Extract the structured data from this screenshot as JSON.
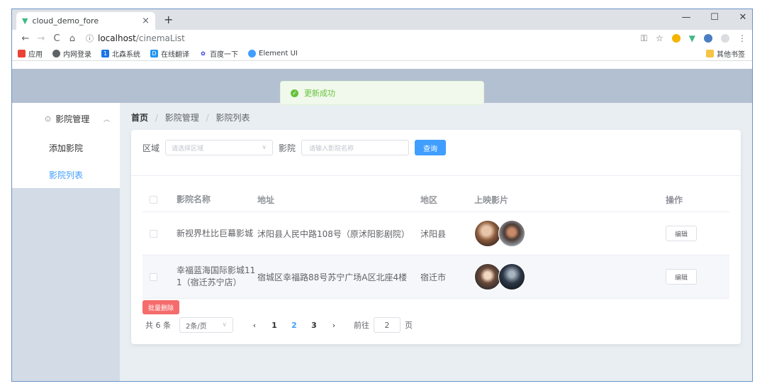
{
  "browser": {
    "tab_title": "cloud_demo_fore",
    "url_host": "localhost",
    "url_path": "/cinemaList",
    "bookmarks": [
      "应用",
      "内网登录",
      "北森系统",
      "在线翻译",
      "百度一下",
      "Element UI"
    ],
    "other_bookmarks": "其他书签"
  },
  "toast": {
    "message": "更新成功"
  },
  "sidebar": {
    "group_title": "影院管理",
    "items": [
      {
        "label": "添加影院"
      },
      {
        "label": "影院列表"
      }
    ]
  },
  "breadcrumb": [
    "首页",
    "影院管理",
    "影院列表"
  ],
  "search": {
    "region_label": "区域",
    "region_placeholder": "请选择区域",
    "cinema_label": "影院",
    "cinema_placeholder": "请输入影院名称",
    "query_button": "查询"
  },
  "table": {
    "headers": [
      "影院名称",
      "地址",
      "地区",
      "上映影片",
      "操作"
    ],
    "rows": [
      {
        "name": "新视界杜比巨幕影城",
        "address": "沭阳县人民中路108号（原沭阳影剧院）",
        "region": "沭阳县",
        "edit": "编辑"
      },
      {
        "name": "幸福蓝海国际影城11\n1（宿迁苏宁店）",
        "address": "宿城区幸福路88号苏宁广场A区北座4楼",
        "region": "宿迁市",
        "edit": "编辑"
      }
    ]
  },
  "batch_delete": "批量删除",
  "pagination": {
    "total": "共 6 条",
    "page_size": "2条/页",
    "pages": [
      "1",
      "2",
      "3"
    ],
    "current": "2",
    "goto_label": "前往",
    "goto_value": "2",
    "page_unit": "页"
  }
}
